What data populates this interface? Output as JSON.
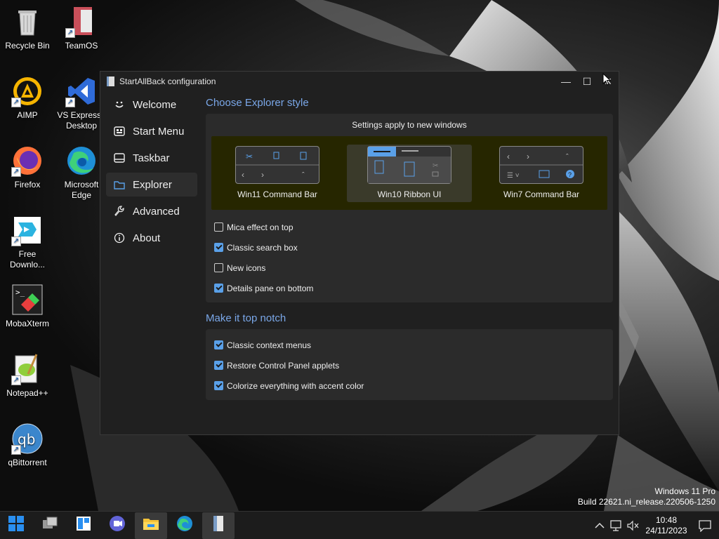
{
  "desktop": {
    "icons": [
      {
        "label": "Recycle Bin",
        "icon": "recycle-bin-icon"
      },
      {
        "label": "TeamOS",
        "icon": "teamos-icon"
      },
      {
        "label": "AIMP",
        "icon": "aimp-icon"
      },
      {
        "label": "VS Express f\nDesktop",
        "icon": "visual-studio-icon"
      },
      {
        "label": "Firefox",
        "icon": "firefox-icon"
      },
      {
        "label": "Microsoft\nEdge",
        "icon": "edge-icon"
      },
      {
        "label": "Free\nDownlo...",
        "icon": "free-download-manager-icon"
      },
      {
        "label": "MobaXterm",
        "icon": "mobaxterm-icon"
      },
      {
        "label": "Notepad++",
        "icon": "notepadpp-icon"
      },
      {
        "label": "qBittorrent",
        "icon": "qbittorrent-icon"
      }
    ]
  },
  "window": {
    "title": "StartAllBack configuration",
    "controls": {
      "minimize": "—",
      "maximize": "☐",
      "close": "✕"
    }
  },
  "sidebar": {
    "items": [
      {
        "label": "Welcome",
        "icon": "smile-icon"
      },
      {
        "label": "Start Menu",
        "icon": "start-menu-icon"
      },
      {
        "label": "Taskbar",
        "icon": "taskbar-icon"
      },
      {
        "label": "Explorer",
        "icon": "folder-icon"
      },
      {
        "label": "Advanced",
        "icon": "wrench-icon"
      },
      {
        "label": "About",
        "icon": "info-icon"
      }
    ],
    "active": "Explorer"
  },
  "explorer": {
    "section1_title": "Choose Explorer style",
    "panel_head": "Settings apply to new windows",
    "styles": [
      {
        "label": "Win11 Command Bar",
        "selected": false
      },
      {
        "label": "Win10 Ribbon UI",
        "selected": true
      },
      {
        "label": "Win7 Command Bar",
        "selected": false
      }
    ],
    "options": [
      {
        "label": "Mica effect on top",
        "checked": false
      },
      {
        "label": "Classic search box",
        "checked": true
      },
      {
        "label": "New icons",
        "checked": false
      },
      {
        "label": "Details pane on bottom",
        "checked": true
      }
    ],
    "section2_title": "Make it top notch",
    "options2": [
      {
        "label": "Classic context menus",
        "checked": true
      },
      {
        "label": "Restore Control Panel applets",
        "checked": true
      },
      {
        "label": "Colorize everything with accent color",
        "checked": true
      }
    ]
  },
  "watermark": {
    "line1": "Windows 11 Pro",
    "line2": "Build 22621.ni_release.220506-1250"
  },
  "taskbar": {
    "time": "10:48",
    "date": "24/11/2023"
  },
  "colors": {
    "accent": "#5aa0e8",
    "heading": "#7aa7e8"
  }
}
